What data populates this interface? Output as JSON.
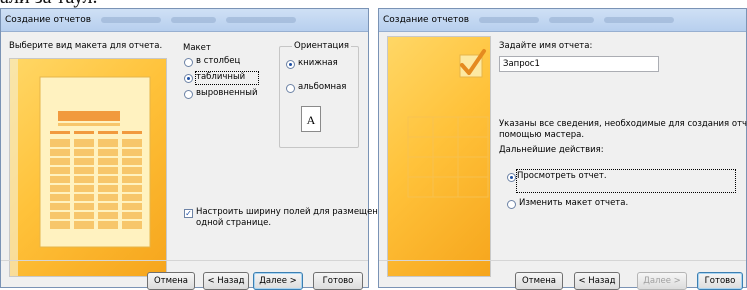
{
  "background_text": "али за таул.",
  "left_dialog": {
    "title": "Создание отчетов",
    "prompt": "Выберите вид макета для отчета.",
    "layout_group": {
      "legend": "Макет",
      "options": [
        "в столбец",
        "табличный",
        "выровненный"
      ],
      "selected": "табличный"
    },
    "orientation_group": {
      "legend": "Ориентация",
      "options": [
        "книжная",
        "альбомная"
      ],
      "selected": "книжная",
      "icon_letter": "A"
    },
    "fit_checkbox": {
      "checked": true,
      "label_line1": "Настроить ширину полей для размещения на",
      "label_line2": "одной странице."
    },
    "buttons": {
      "cancel": "Отмена",
      "back": "< Назад",
      "next": "Далее >",
      "finish": "Готово"
    }
  },
  "right_dialog": {
    "title": "Создание отчетов",
    "name_prompt": "Задайте имя отчета:",
    "name_value": "Запрос1",
    "info_line1": "Указаны все сведения, необходимые для создания отчета с",
    "info_line2": "помощью мастера.",
    "next_actions": "Дальнейшие действия:",
    "options": [
      "Просмотреть отчет.",
      "Изменить макет отчета."
    ],
    "selected": "Просмотреть отчет.",
    "buttons": {
      "cancel": "Отмена",
      "back": "< Назад",
      "next": "Далее >",
      "finish": "Готово"
    }
  },
  "colors": {
    "preview_yellow": "#ffc23a",
    "preview_orange": "#f6a51c",
    "title_bar": "#b7cfee",
    "accent_blue": "#1e4fa3"
  }
}
